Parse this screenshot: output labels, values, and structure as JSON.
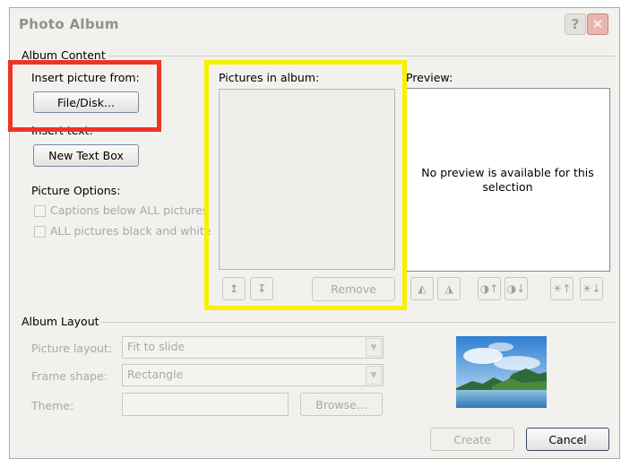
{
  "window": {
    "title": "Photo Album"
  },
  "album_content": {
    "group_label": "Album Content",
    "insert_picture_label": "Insert picture from:",
    "file_disk_button": "File/Disk...",
    "insert_text_label": "Insert text:",
    "new_text_box_button": "New Text Box",
    "picture_options_label": "Picture Options:",
    "captions_option": "Captions below ALL pictures",
    "black_white_option": "ALL pictures black and white",
    "pictures_in_album_label": "Pictures in album:",
    "move_up_icon": "move-up-arrow",
    "move_down_icon": "move-down-arrow",
    "remove_button": "Remove",
    "preview_label": "Preview:",
    "preview_message": "No preview is available for this selection"
  },
  "album_layout": {
    "group_label": "Album Layout",
    "picture_layout_label": "Picture layout:",
    "picture_layout_value": "Fit to slide",
    "frame_shape_label": "Frame shape:",
    "frame_shape_value": "Rectangle",
    "theme_label": "Theme:",
    "browse_button": "Browse..."
  },
  "footer": {
    "create_button": "Create",
    "cancel_button": "Cancel"
  },
  "colors": {
    "highlight_red": "#ee3423",
    "highlight_yellow": "#f7f000"
  }
}
